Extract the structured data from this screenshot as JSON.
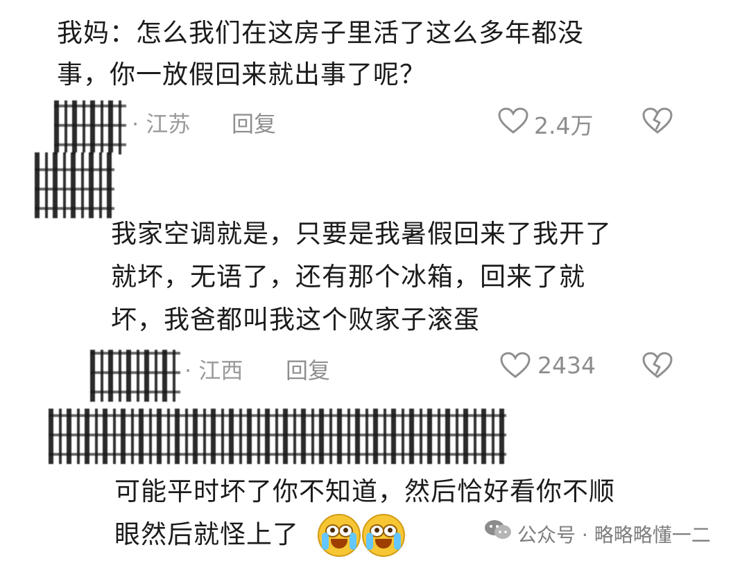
{
  "comments": [
    {
      "text_lines": [
        "我妈：怎么我们在这房子里活了这么多年都没",
        "事，你一放假回来就出事了呢？"
      ],
      "meta": "· 江苏",
      "reply": "回复",
      "likes": "2.4万"
    },
    {
      "text_lines": [
        "我家空调就是，只要是我暑假回来了我开了",
        "就坏，无语了，还有那个冰箱，回来了就",
        "坏，我爸都叫我这个败家子滚蛋"
      ],
      "meta": "· 江西",
      "reply": "回复",
      "likes": "2434"
    },
    {
      "text_lines": [
        "可能平时坏了你不知道，然后恰好看你不顺",
        "眼然后就怪上了"
      ],
      "emoji_names": [
        "crying-face-emoji",
        "crying-face-emoji"
      ]
    }
  ],
  "watermark": {
    "text": "公众号 · 略略略懂一二",
    "icon_name": "wechat-icon"
  },
  "icon_names": {
    "like": "heart-icon",
    "dislike": "broken-heart-icon"
  }
}
